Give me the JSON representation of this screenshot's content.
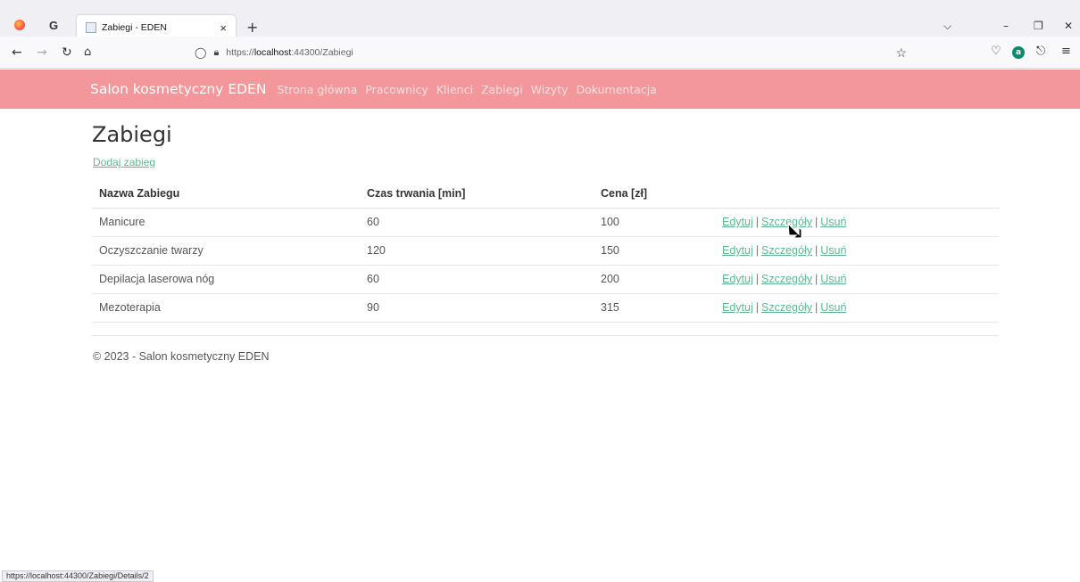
{
  "browser": {
    "tab_title": "Zabiegi - EDEN",
    "tab_close": "×",
    "new_tab": "+",
    "url_scheme": "https://",
    "url_host": "localhost",
    "url_path": ":44300/Zabiegi",
    "status_url": "https://localhost:44300/Zabiegi/Details/2",
    "icons": [
      "firefox-icon",
      "google-icon",
      "back-icon",
      "forward-icon",
      "reload-icon",
      "home-icon",
      "shield-icon",
      "lock-icon",
      "star-icon",
      "pocket-icon",
      "account-icon",
      "extensions-icon",
      "menu-icon"
    ]
  },
  "site": {
    "brand": "Salon kosmetyczny EDEN",
    "nav": [
      "Strona główna",
      "Pracownicy",
      "Klienci",
      "Zabiegi",
      "Wizyty",
      "Dokumentacja"
    ]
  },
  "main": {
    "title": "Zabiegi",
    "add_link": "Dodaj zabieg",
    "columns": [
      "Nazwa Zabiegu",
      "Czas trwania [min]",
      "Cena [zł]",
      ""
    ],
    "rows": [
      {
        "name": "Manicure",
        "duration": "60",
        "price": "100"
      },
      {
        "name": "Oczyszczanie twarzy",
        "duration": "120",
        "price": "150"
      },
      {
        "name": "Depilacja laserowa nóg",
        "duration": "60",
        "price": "200"
      },
      {
        "name": "Mezoterapia",
        "duration": "90",
        "price": "315"
      }
    ],
    "actions": {
      "edit": "Edytuj",
      "details": "Szczegóły",
      "delete": "Usuń",
      "separator": "|"
    }
  },
  "footer": {
    "text": "© 2023 - Salon kosmetyczny EDEN"
  }
}
